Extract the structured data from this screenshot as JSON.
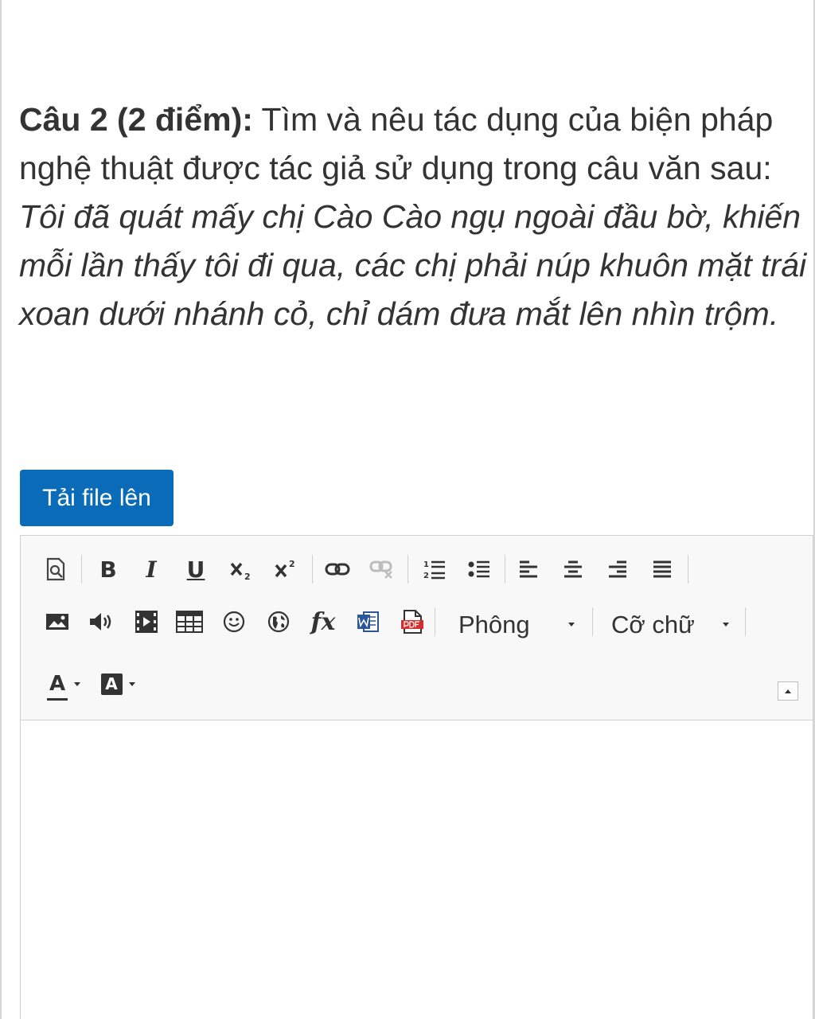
{
  "question": {
    "label": "Câu 2 (2 điểm):",
    "prompt": " Tìm và nêu tác dụng của biện pháp nghệ thuật được tác giả sử dụng trong câu văn sau: ",
    "quote": "Tôi đã quát mấy chị Cào Cào ngụ ngoài đầu bờ, khiến mỗi lần thấy tôi đi qua, các chị phải núp khuôn mặt trái xoan dưới nhánh cỏ, chỉ dám đưa mắt lên nhìn trộm."
  },
  "upload_button": {
    "label": "Tải file lên",
    "color": "#0a6cb8"
  },
  "toolbar": {
    "row1": {
      "bold": "B",
      "italic": "I",
      "underline": "U"
    },
    "font_select": {
      "value": "Phông"
    },
    "size_select": {
      "value": "Cỡ chữ"
    },
    "text_color": {
      "label": "A"
    },
    "bg_color": {
      "label": "A"
    },
    "fx_label": "fx",
    "icons": [
      "preview-icon",
      "bold-icon",
      "italic-icon",
      "underline-icon",
      "subscript-icon",
      "superscript-icon",
      "link-icon",
      "unlink-icon",
      "numbered-list-icon",
      "bulleted-list-icon",
      "align-left-icon",
      "align-center-icon",
      "align-right-icon",
      "align-justify-icon",
      "image-icon",
      "audio-icon",
      "video-icon",
      "table-icon",
      "smiley-icon",
      "globe-icon",
      "formula-icon",
      "word-icon",
      "pdf-icon",
      "text-color-icon",
      "background-color-icon",
      "collapse-toolbar-icon"
    ]
  },
  "editor": {
    "content": ""
  }
}
